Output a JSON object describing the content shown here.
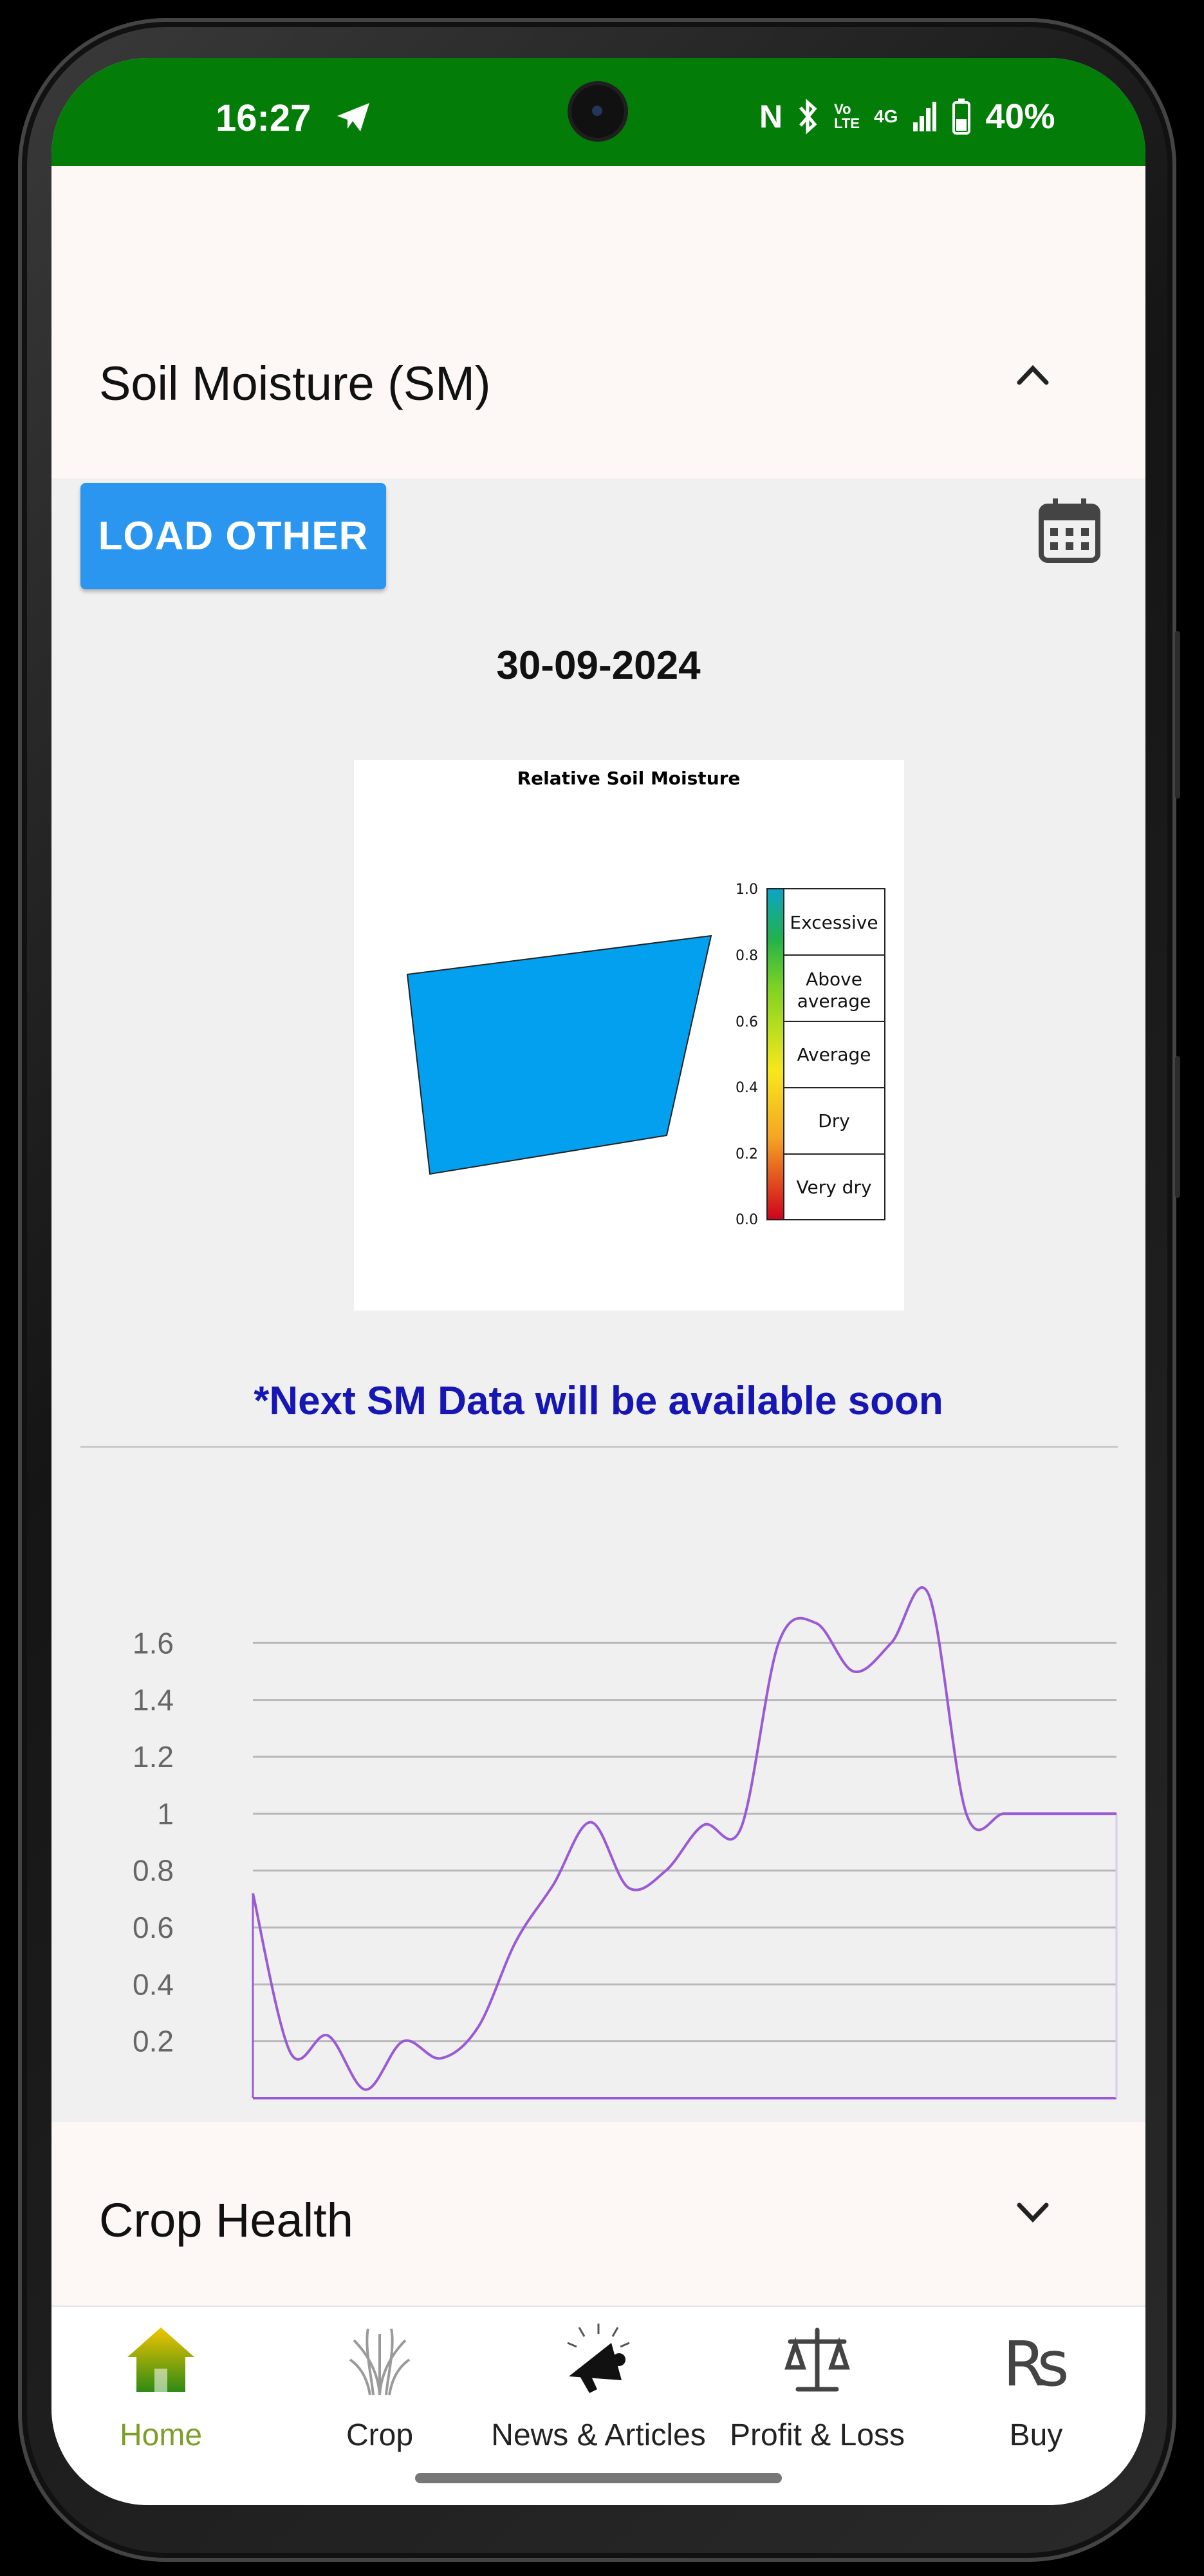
{
  "status_bar": {
    "time": "16:27",
    "battery": "40%",
    "network": "4G",
    "volte": "Vo LTE",
    "icons": [
      "telegram-icon",
      "nfc-icon",
      "bluetooth-icon",
      "signal-icon",
      "battery-icon"
    ],
    "color": "#047d08"
  },
  "soil_moisture": {
    "section_title": "Soil Moisture (SM)",
    "load_button": "LOAD OTHER",
    "date": "30-09-2024",
    "note": "*Next SM Data will be available soon",
    "map_image": {
      "title": "Relative Soil Moisture",
      "field_color": "#03a0f0",
      "colorbar_ticks": [
        "0.0",
        "0.2",
        "0.4",
        "0.6",
        "0.8",
        "1.0"
      ],
      "classes": [
        "Very dry",
        "Dry",
        "Average",
        "Above average",
        "Excessive"
      ]
    }
  },
  "chart_data": {
    "type": "line",
    "title": "",
    "xlabel": "",
    "ylabel": "",
    "y_ticks": [
      "0.2",
      "0.4",
      "0.6",
      "0.8",
      "1",
      "1.2",
      "1.4",
      "1.6"
    ],
    "ylim": [
      0,
      1.6
    ],
    "grid": true,
    "line_color": "#9a5ad6",
    "x": [
      0,
      1,
      2,
      3,
      4,
      5,
      6,
      7,
      8,
      9,
      10,
      11,
      12,
      13,
      14,
      15,
      16,
      17,
      18,
      19,
      20,
      21,
      22,
      23
    ],
    "values": [
      0.72,
      0.16,
      0.22,
      0.03,
      0.2,
      0.14,
      0.25,
      0.55,
      0.75,
      0.97,
      0.74,
      0.8,
      0.96,
      0.95,
      1.6,
      1.67,
      1.5,
      1.6,
      1.77,
      1.0,
      1.0,
      1.0,
      1.0,
      1.0
    ]
  },
  "crop_health": {
    "section_title": "Crop Health"
  },
  "nav": {
    "active": "Home",
    "active_color": "#7d9e2a",
    "items": [
      {
        "label": "Home",
        "icon": "home-icon"
      },
      {
        "label": "Crop",
        "icon": "crop-icon"
      },
      {
        "label": "News & Articles",
        "icon": "megaphone-icon"
      },
      {
        "label": "Profit & Loss",
        "icon": "scale-icon"
      },
      {
        "label": "Buy",
        "icon": "rupee-icon"
      }
    ]
  }
}
